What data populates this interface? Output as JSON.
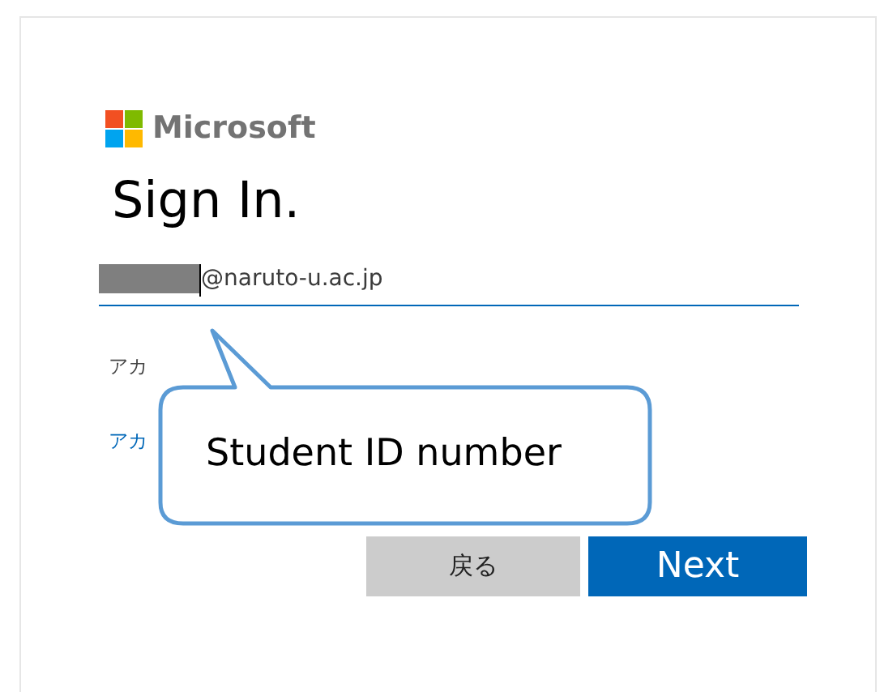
{
  "logo": {
    "text": "Microsoft"
  },
  "title": "Sign In.",
  "account_field": {
    "redacted": true,
    "value": "@naruto-u.ac.jp"
  },
  "hint_text": "アカ",
  "link_text": "アカ",
  "buttons": [
    {
      "label": "戻る",
      "kind": "secondary"
    },
    {
      "label": "Next",
      "kind": "primary"
    }
  ],
  "callout": {
    "text": "Student ID number"
  }
}
